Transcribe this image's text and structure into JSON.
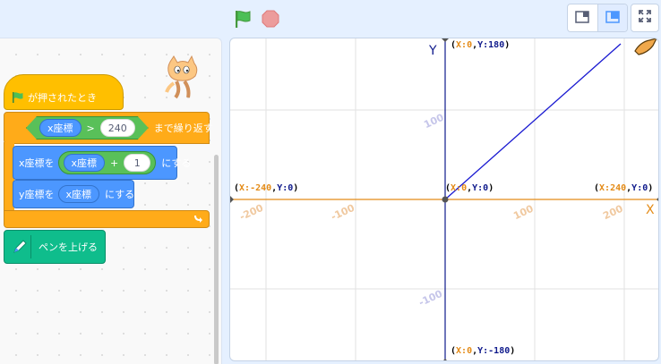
{
  "toolbar": {
    "green_flag_icon": "green-flag-icon",
    "stop_icon": "stop-icon",
    "small_stage_icon": "small-stage-icon",
    "normal_stage_icon": "normal-stage-icon",
    "fullscreen_icon": "fullscreen-icon"
  },
  "colors": {
    "background": "#e5f0ff",
    "events": "#ffbf00",
    "control": "#ffab19",
    "motion": "#4c97ff",
    "operator": "#59c059",
    "pen": "#0fbd8c",
    "axis_x": "#e48b17",
    "axis_y": "#0f1a8c",
    "line": "#1a1ad1"
  },
  "script": {
    "hat_label": "が押されたとき",
    "repeat": {
      "left_reporter": "x座標",
      "operator": ">",
      "right_value": "240",
      "label": "まで繰り返す"
    },
    "change_x": {
      "label": "x座標を",
      "reporter": "x座標",
      "operator": "+",
      "value": "1",
      "suffix": "にする"
    },
    "set_y": {
      "label": "y座標を",
      "reporter": "x座標",
      "suffix": "にする"
    },
    "pen_up": {
      "label": "ペンを上げる"
    }
  },
  "stage": {
    "axis_x_name": "X",
    "axis_y_name": "Y",
    "labels": {
      "top": {
        "x": "X:0",
        "y": "Y:180"
      },
      "bottom": {
        "x": "X:0",
        "y": "Y:-180"
      },
      "left": {
        "x": "X:-240",
        "y": "Y:0"
      },
      "right": {
        "x": "X:240",
        "y": "Y:0"
      },
      "origin": {
        "x": "X:0",
        "y": "Y:0"
      }
    },
    "ticks": {
      "x_neg_200": "-200",
      "x_neg_100": "-100",
      "x_100": "100",
      "x_200": "200",
      "y_100": "100",
      "y_neg_100": "-100"
    }
  }
}
